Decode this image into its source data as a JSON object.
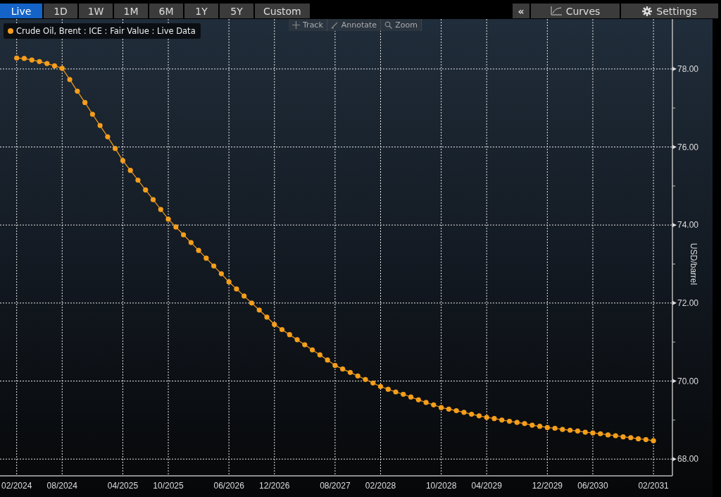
{
  "range_tabs": [
    {
      "label": "Live",
      "selected": true
    },
    {
      "label": "1D",
      "selected": false
    },
    {
      "label": "1W",
      "selected": false
    },
    {
      "label": "1M",
      "selected": false
    },
    {
      "label": "6M",
      "selected": false
    },
    {
      "label": "1Y",
      "selected": false
    },
    {
      "label": "5Y",
      "selected": false
    },
    {
      "label": "Custom",
      "selected": false
    }
  ],
  "collapse_button": "«",
  "curves_button": "Curves",
  "settings_button": "Settings",
  "chart_tools": [
    {
      "kind": "track",
      "label": "Track"
    },
    {
      "kind": "annotate",
      "label": "Annotate"
    },
    {
      "kind": "zoom",
      "label": "Zoom"
    }
  ],
  "chart_data": {
    "type": "line",
    "ylabel": "USD/barrel",
    "categories": [
      "02/2024",
      null,
      null,
      null,
      null,
      null,
      "08/2024",
      null,
      null,
      null,
      null,
      null,
      null,
      null,
      "04/2025",
      null,
      null,
      null,
      null,
      null,
      "10/2025",
      null,
      null,
      null,
      null,
      null,
      null,
      null,
      "06/2026",
      null,
      null,
      null,
      null,
      null,
      "12/2026",
      null,
      null,
      null,
      null,
      null,
      null,
      null,
      "08/2027",
      null,
      null,
      null,
      null,
      null,
      "02/2028",
      null,
      null,
      null,
      null,
      null,
      null,
      null,
      "10/2028",
      null,
      null,
      null,
      null,
      null,
      "04/2029",
      null,
      null,
      null,
      null,
      null,
      null,
      null,
      "12/2029",
      null,
      null,
      null,
      null,
      null,
      "06/2030",
      null,
      null,
      null,
      null,
      null,
      null,
      null,
      "02/2031"
    ],
    "series": [
      {
        "name": "Crude Oil, Brent : ICE : Fair Value : Live Data",
        "color": "#f59e1b",
        "marker": "circle",
        "values": [
          78.28,
          78.27,
          78.23,
          78.19,
          78.14,
          78.08,
          78.02,
          77.73,
          77.43,
          77.14,
          76.84,
          76.55,
          76.26,
          75.96,
          75.65,
          75.4,
          75.15,
          74.9,
          74.65,
          74.4,
          74.15,
          73.95,
          73.75,
          73.55,
          73.35,
          73.15,
          72.95,
          72.75,
          72.54,
          72.36,
          72.18,
          72.0,
          71.82,
          71.64,
          71.45,
          71.32,
          71.19,
          71.06,
          70.93,
          70.8,
          70.67,
          70.54,
          70.4,
          70.31,
          70.22,
          70.13,
          70.04,
          69.95,
          69.86,
          69.79,
          69.72,
          69.66,
          69.59,
          69.52,
          69.45,
          69.39,
          69.32,
          69.28,
          69.24,
          69.2,
          69.15,
          69.11,
          69.07,
          69.04,
          69.0,
          68.97,
          68.94,
          68.91,
          68.87,
          68.84,
          68.81,
          68.79,
          68.76,
          68.74,
          68.72,
          68.69,
          68.67,
          68.65,
          68.62,
          68.6,
          68.57,
          68.55,
          68.52,
          68.5,
          68.47
        ]
      }
    ],
    "grid": true,
    "ylim": [
      67.57,
      79.28
    ],
    "yticks": [
      {
        "value": 68,
        "label": "68.00"
      },
      {
        "value": 70,
        "label": "70.00"
      },
      {
        "value": 72,
        "label": "72.00"
      },
      {
        "value": 74,
        "label": "74.00"
      },
      {
        "value": 76,
        "label": "76.00"
      },
      {
        "value": 78,
        "label": "78.00"
      }
    ]
  }
}
